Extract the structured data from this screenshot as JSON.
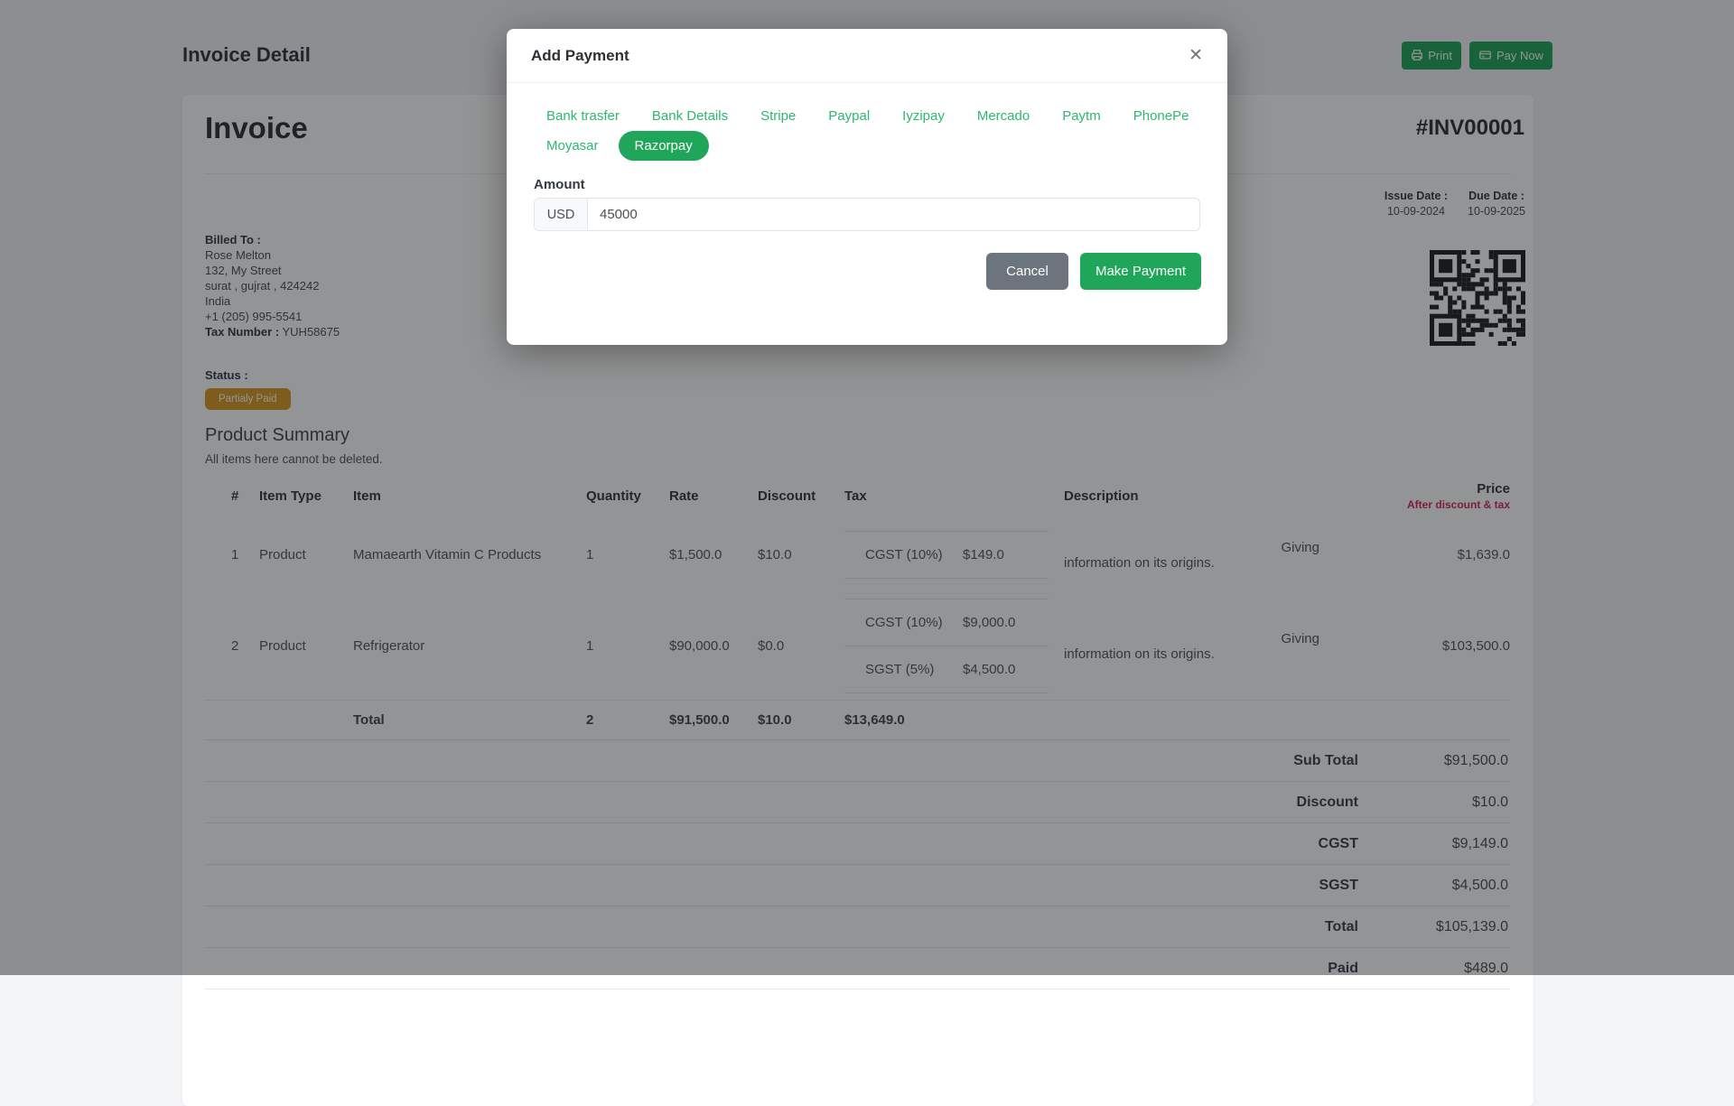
{
  "colors": {
    "accent_green": "#1fa65a",
    "tab_green": "#2cb872",
    "badge_amber": "#d99a25",
    "price_sub_red": "#d22b5a"
  },
  "page": {
    "title": "Invoice Detail",
    "print_label": "Print",
    "pay_now_label": "Pay Now"
  },
  "invoice": {
    "heading": "Invoice",
    "number": "#INV00001",
    "issue_date_label": "Issue Date :",
    "issue_date": "10-09-2024",
    "due_date_label": "Due Date :",
    "due_date": "10-09-2025",
    "billed_to_label": "Billed To :",
    "billed_to": [
      "Rose Melton",
      "132, My Street",
      "surat , gujrat , 424242",
      "India",
      "+1 (205) 995-5541"
    ],
    "tax_number_label": "Tax Number :",
    "tax_number": "YUH58675",
    "status_label": "Status :",
    "status_badge": "Partialy Paid"
  },
  "product_summary": {
    "title": "Product Summary",
    "subtitle": "All items here cannot be deleted.",
    "columns": {
      "num": "#",
      "item_type": "Item Type",
      "item": "Item",
      "quantity": "Quantity",
      "rate": "Rate",
      "discount": "Discount",
      "tax": "Tax",
      "description": "Description",
      "price": "Price",
      "price_sub": "After discount & tax"
    },
    "rows": [
      {
        "num": "1",
        "item_type": "Product",
        "item": "Mamaearth Vitamin C Products",
        "quantity": "1",
        "rate": "$1,500.0",
        "discount": "$10.0",
        "taxes": [
          {
            "name": "CGST (10%)",
            "amount": "$149.0"
          }
        ],
        "description_line1": "Giving",
        "description_line2": "information on its origins.",
        "price": "$1,639.0"
      },
      {
        "num": "2",
        "item_type": "Product",
        "item": "Refrigerator",
        "quantity": "1",
        "rate": "$90,000.0",
        "discount": "$0.0",
        "taxes": [
          {
            "name": "CGST (10%)",
            "amount": "$9,000.0"
          },
          {
            "name": "SGST (5%)",
            "amount": "$4,500.0"
          }
        ],
        "description_line1": "Giving",
        "description_line2": "information on its origins.",
        "price": "$103,500.0"
      }
    ],
    "total_row": {
      "label": "Total",
      "quantity": "2",
      "rate": "$91,500.0",
      "discount": "$10.0",
      "tax": "$13,649.0"
    },
    "summary_rows": [
      {
        "label": "Sub Total",
        "value": "$91,500.0"
      },
      {
        "label": "Discount",
        "value": "$10.0"
      },
      {
        "label": "CGST",
        "value": "$9,149.0"
      },
      {
        "label": "SGST",
        "value": "$4,500.0"
      },
      {
        "label": "Total",
        "value": "$105,139.0"
      },
      {
        "label": "Paid",
        "value": "$489.0"
      }
    ]
  },
  "modal": {
    "title": "Add Payment",
    "close_label": "✕",
    "tabs": [
      "Bank trasfer",
      "Bank Details",
      "Stripe",
      "Paypal",
      "Iyzipay",
      "Mercado",
      "Paytm",
      "PhonePe",
      "Moyasar",
      "Razorpay"
    ],
    "active_tab": "Razorpay",
    "amount_label": "Amount",
    "currency": "USD",
    "amount_value": "45000",
    "cancel_label": "Cancel",
    "submit_label": "Make Payment"
  }
}
